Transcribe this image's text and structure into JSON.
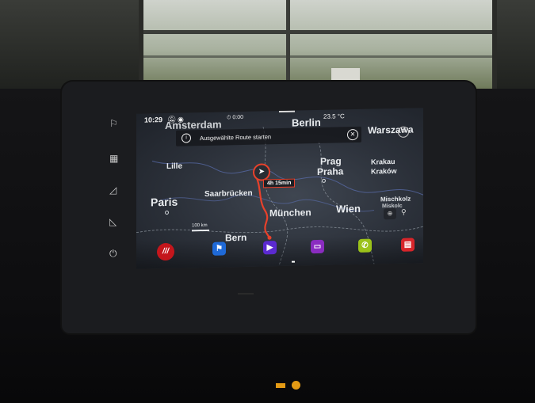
{
  "status_bar": {
    "time": "10:29",
    "muted_icon": "bell-off-icon",
    "connectivity_icon": "wifi-icon",
    "timer": "⏱ 0:00",
    "temperature": "23.5 °C"
  },
  "toast": {
    "info_icon": "info-icon",
    "message": "Ausgewählte Route starten",
    "close_icon": "close-icon"
  },
  "map": {
    "cities": {
      "amsterdam": "Amsterdam",
      "berlin": "Berlin",
      "warszawa": "Warszawa",
      "lille": "Lille",
      "prag": "Prag",
      "praha": "Praha",
      "krakau": "Krakau",
      "krakow": "Kraków",
      "paris": "Paris",
      "saarbruecken": "Saarbrücken",
      "muenchen": "München",
      "wien": "Wien",
      "mischkolz": "Mischkolz",
      "miskolc": "Miskolc",
      "bern": "Bern"
    },
    "route_duration": "4h 15min",
    "scale_label": "100 km",
    "route_color": "#e8412b",
    "compass_icon": "navigation-arrow-icon"
  },
  "dock": {
    "apps": [
      {
        "name": "speed-app",
        "glyph": "///",
        "color": "#c4161c"
      },
      {
        "name": "flag-app",
        "glyph": "⚑",
        "color": "#1f6ad8"
      },
      {
        "name": "media-app",
        "glyph": "▶",
        "color": "#5b2ad0"
      },
      {
        "name": "radio-app",
        "glyph": "▭",
        "color": "#8a2cc0"
      },
      {
        "name": "phone-app",
        "glyph": "✆",
        "color": "#9bc21a"
      },
      {
        "name": "car-app",
        "glyph": "▤",
        "color": "#d7252a"
      }
    ]
  },
  "side_buttons": {
    "flag_icon": "flag-icon",
    "display_icon": "display-icon",
    "volume_up_icon": "volume-up-icon",
    "volume_down_icon": "volume-down-icon",
    "power_icon": "power-icon"
  }
}
